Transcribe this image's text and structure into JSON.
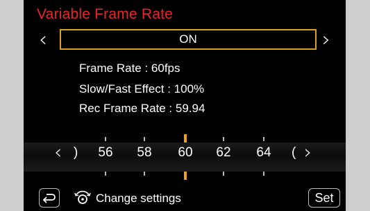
{
  "title": "Variable Frame Rate",
  "setting": {
    "value": "ON",
    "prev_icon": "chevron-left-icon",
    "next_icon": "chevron-right-icon"
  },
  "info": {
    "frame_rate": "Frame Rate : 60fps",
    "slow_fast_effect": "Slow/Fast Effect : 100%",
    "rec_frame_rate": "Rec Frame Rate : 59.94"
  },
  "dial": {
    "selected": "60",
    "left_partial": ")",
    "right_partial": "(",
    "values": [
      "56",
      "58",
      "60",
      "62",
      "64"
    ]
  },
  "footer": {
    "back_icon": "return-icon",
    "dial_icon": "rear-dial-icon",
    "change_label": "Change settings",
    "set_label": "Set"
  },
  "colors": {
    "title": "#e8262a",
    "highlight": "#d8a21c",
    "background": "#000000"
  }
}
